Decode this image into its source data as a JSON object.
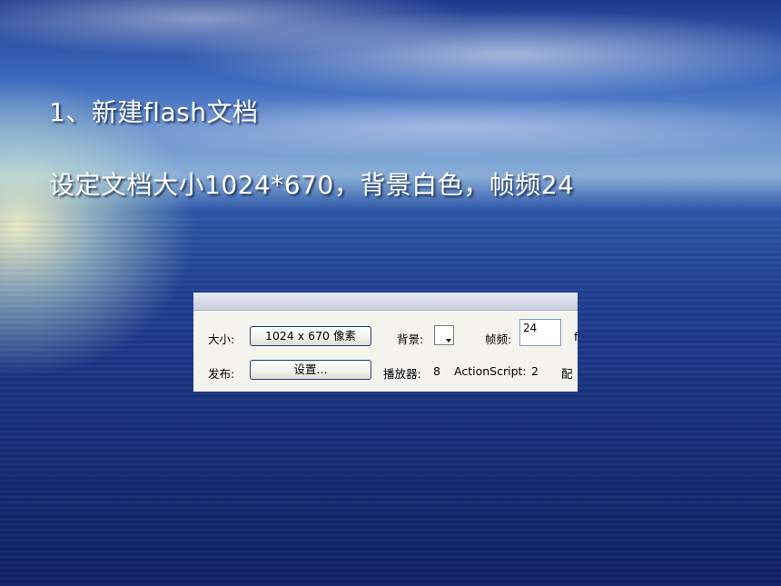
{
  "slide": {
    "heading": "1、新建flash文档",
    "subtitle": "设定文档大小1024*670，背景白色，帧频24"
  },
  "properties_panel": {
    "size_label": "大小:",
    "size_button": "1024 x 670 像素",
    "background_label": "背景:",
    "background_color": "#ffffff",
    "fps_label": "帧频:",
    "fps_value": "24",
    "fps_cut_label": "f",
    "publish_label": "发布:",
    "settings_button": "设置...",
    "player_label": "播放器:",
    "player_value": "8",
    "actionscript_label": "ActionScript:",
    "actionscript_value": "2",
    "profile_label_cut": "配"
  },
  "colors": {
    "slide_text": "#ffffff",
    "panel_background": "#ece9d8",
    "button_border": "#1e3d7a"
  }
}
